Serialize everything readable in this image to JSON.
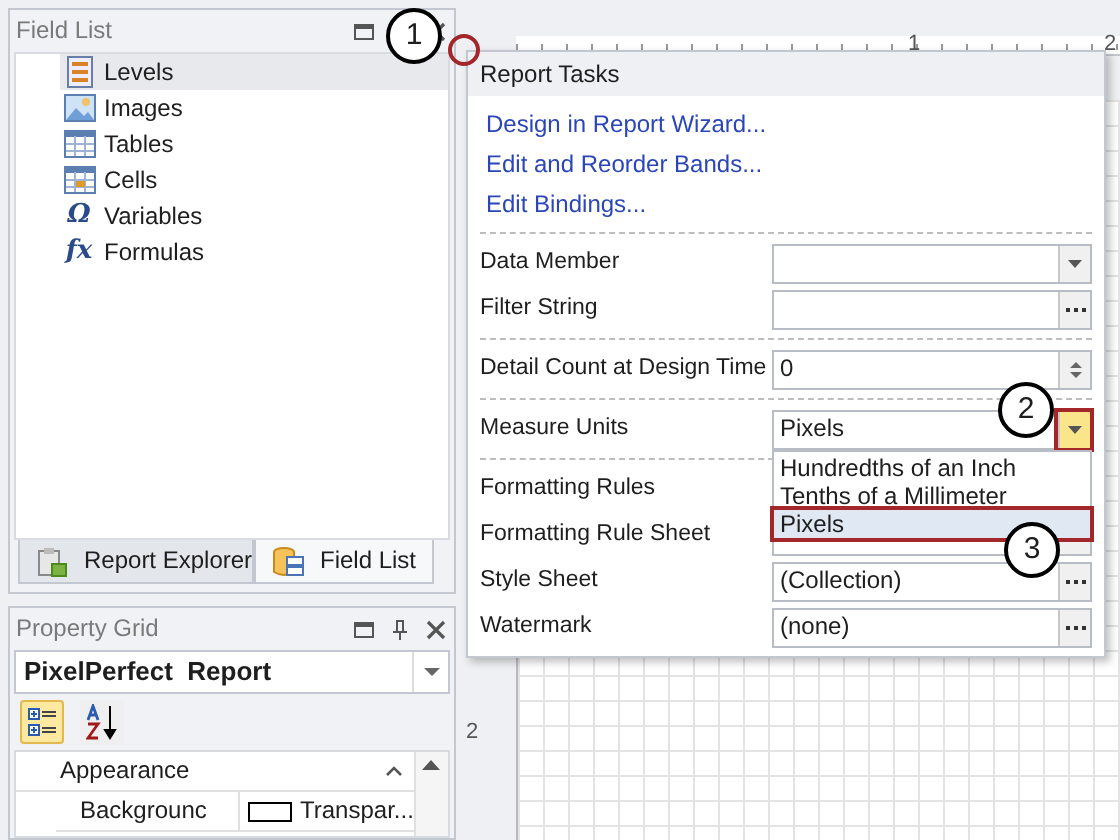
{
  "field_list": {
    "title": "Field List",
    "items": [
      {
        "kind": "levels",
        "label": "Levels",
        "selected": true
      },
      {
        "kind": "images",
        "label": "Images",
        "selected": false
      },
      {
        "kind": "tables",
        "label": "Tables",
        "selected": false
      },
      {
        "kind": "cells",
        "label": "Cells",
        "selected": false
      },
      {
        "kind": "glyph",
        "glyph": "Ω",
        "label": "Variables",
        "selected": false
      },
      {
        "kind": "glyph",
        "glyph": "fx",
        "label": "Formulas",
        "selected": false
      }
    ],
    "tabs": [
      {
        "kind": "explorer",
        "label": "Report Explorer",
        "selected": true
      },
      {
        "kind": "fields",
        "label": "Field List",
        "selected": false
      }
    ]
  },
  "property_grid": {
    "title": "Property Grid",
    "object_name": "PixelPerfect  Report",
    "toolbar": [
      {
        "kind": "categorized",
        "selected": true
      },
      {
        "kind": "alphabetical",
        "selected": false
      }
    ],
    "category": {
      "label": "Appearance",
      "expanded": true
    },
    "rows": [
      {
        "name": "Backgrounc",
        "value": "Transpar...",
        "color": "#ffffff"
      }
    ]
  },
  "ruler": {
    "top_marks": [
      "1",
      "2"
    ],
    "left_marks": [
      "2"
    ]
  },
  "report_tasks": {
    "title": "Report Tasks",
    "links": [
      "Design in Report Wizard...",
      "Edit and Reorder Bands...",
      "Edit Bindings..."
    ],
    "sections": [
      [
        {
          "kind": "combo",
          "label": "Data Member"
        },
        {
          "kind": "ellipsis",
          "label": "Filter String"
        }
      ],
      [
        {
          "kind": "spin",
          "label": "Detail Count at Design Time",
          "value": "0"
        }
      ],
      [
        {
          "kind": "combo",
          "label": "Measure Units",
          "value": "Pixels",
          "open": true,
          "options": [
            {
              "label": "Hundredths of an Inch",
              "selected": false
            },
            {
              "label": "Tenths of a Millimeter",
              "selected": false
            },
            {
              "label": "Pixels",
              "selected": true
            }
          ]
        }
      ],
      [
        {
          "kind": "combo",
          "label": "Formatting Rules"
        },
        {
          "kind": "ellipsis",
          "label": "Formatting Rule Sheet"
        },
        {
          "kind": "ellipsis",
          "label": "Style Sheet",
          "value": "(Collection)"
        },
        {
          "kind": "ellipsis",
          "label": "Watermark",
          "value": "(none)"
        }
      ]
    ]
  },
  "callouts": [
    "1",
    "2",
    "3"
  ]
}
